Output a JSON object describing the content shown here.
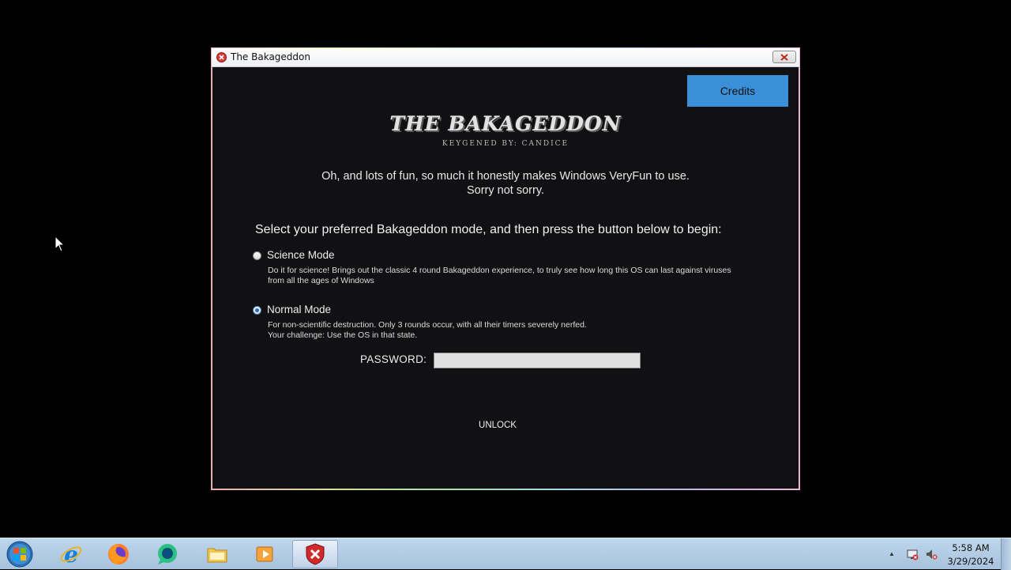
{
  "window": {
    "title": "The Bakageddon",
    "credits_label": "Credits",
    "logo_title": "THE BAKAGEDDON",
    "logo_subtitle": "KEYGENED BY: CANDICE",
    "intro_line1": "Oh, and lots of fun, so much it honestly makes Windows VeryFun to use.",
    "intro_line2": "Sorry not sorry.",
    "select_text": "Select your preferred Bakageddon mode, and then press the button below to begin:",
    "modes": [
      {
        "label": "Science Mode",
        "selected": false,
        "description": "Do it for science! Brings out the classic 4 round Bakageddon experience, to truly see how long this OS can last against viruses from all the ages of Windows"
      },
      {
        "label": "Normal Mode",
        "selected": true,
        "description_line1": "For non-scientific destruction. Only 3 rounds occur, with all their timers severely nerfed.",
        "description_line2": "Your challenge: Use the OS in that state."
      }
    ],
    "password_label": "PASSWORD:",
    "password_value": "",
    "unlock_label": "UNLOCK"
  },
  "taskbar": {
    "items": [
      "start-orb",
      "internet-explorer-icon",
      "firefox-icon",
      "chat-icon",
      "file-explorer-icon",
      "media-player-icon",
      "bakageddon-app-icon"
    ],
    "active_item": "bakageddon-app-icon",
    "clock_time": "5:58 AM",
    "clock_date": "3/29/2024"
  },
  "colors": {
    "window_bg": "#111113",
    "credits_button": "#3a8fd8",
    "taskbar": "#a7c2dd",
    "desktop": "#000000"
  }
}
